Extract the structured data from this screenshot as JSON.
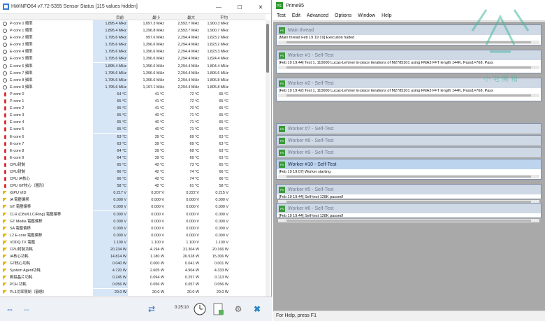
{
  "hwinfo": {
    "title": "HWiNFO64 v7.72-5355 Sensor Status [115 values hidden]",
    "headers": {
      "current": "目前",
      "min": "最小",
      "max": "最大",
      "avg": "平均"
    },
    "rows": [
      {
        "icon": "clock-icon",
        "name": "P-core 0 頻率",
        "cur": "1,895.4 MHz",
        "min": "1,097.3 MHz",
        "max": "2,593.7 MHz",
        "avg": "1,900.3 MHz"
      },
      {
        "icon": "clock-icon",
        "name": "P-core 1 頻率",
        "cur": "1,895.4 MHz",
        "min": "1,296.8 MHz",
        "max": "2,593.7 MHz",
        "avg": "1,900.7 MHz"
      },
      {
        "icon": "clock-icon",
        "name": "E-core 2 頻率",
        "cur": "1,795.6 MHz",
        "min": "997.6 MHz",
        "max": "2,294.4 MHz",
        "avg": "1,823.2 MHz"
      },
      {
        "icon": "clock-icon",
        "name": "E-core 3 頻率",
        "cur": "1,795.6 MHz",
        "min": "1,396.6 MHz",
        "max": "2,294.4 MHz",
        "avg": "1,823.2 MHz"
      },
      {
        "icon": "clock-icon",
        "name": "E-core 4 頻率",
        "cur": "1,795.6 MHz",
        "min": "1,396.6 MHz",
        "max": "2,294.4 MHz",
        "avg": "1,823.3 MHz"
      },
      {
        "icon": "clock-icon",
        "name": "E-core 5 頻率",
        "cur": "1,795.6 MHz",
        "min": "1,396.6 MHz",
        "max": "2,294.4 MHz",
        "avg": "1,824.4 MHz"
      },
      {
        "icon": "clock-icon",
        "name": "E-core 6 頻率",
        "cur": "1,895.4 MHz",
        "min": "1,396.6 MHz",
        "max": "2,294.4 MHz",
        "avg": "1,804.4 MHz"
      },
      {
        "icon": "clock-icon",
        "name": "E-core 7 頻率",
        "cur": "1,795.6 MHz",
        "min": "1,396.6 MHz",
        "max": "2,294.4 MHz",
        "avg": "1,806.6 MHz"
      },
      {
        "icon": "clock-icon",
        "name": "E-core 8 頻率",
        "cur": "1,795.6 MHz",
        "min": "1,396.6 MHz",
        "max": "2,294.4 MHz",
        "avg": "1,806.8 MHz"
      },
      {
        "icon": "clock-icon",
        "name": "E-core 9 頻率",
        "cur": "1,795.6 MHz",
        "min": "1,197.1 MHz",
        "max": "2,294.4 MHz",
        "avg": "1,805.8 MHz"
      },
      {
        "icon": "thermometer-icon",
        "name": "P-core 0",
        "cur": "64 °C",
        "min": "41 °C",
        "max": "72 °C",
        "avg": "65 °C"
      },
      {
        "icon": "thermometer-icon",
        "name": "P-core 1",
        "cur": "65 °C",
        "min": "41 °C",
        "max": "72 °C",
        "avg": "65 °C"
      },
      {
        "icon": "thermometer-icon",
        "name": "E-core 2",
        "cur": "65 °C",
        "min": "41 °C",
        "max": "70 °C",
        "avg": "65 °C"
      },
      {
        "icon": "thermometer-icon",
        "name": "E-core 3",
        "cur": "65 °C",
        "min": "40 °C",
        "max": "71 °C",
        "avg": "65 °C"
      },
      {
        "icon": "thermometer-icon",
        "name": "E-core 4",
        "cur": "65 °C",
        "min": "40 °C",
        "max": "71 °C",
        "avg": "65 °C"
      },
      {
        "icon": "thermometer-icon",
        "name": "E-core 5",
        "cur": "65 °C",
        "min": "40 °C",
        "max": "71 °C",
        "avg": "65 °C"
      },
      {
        "icon": "thermometer-icon",
        "name": "E-core 6",
        "cur": "63 °C",
        "min": "39 °C",
        "max": "69 °C",
        "avg": "63 °C"
      },
      {
        "icon": "thermometer-icon",
        "name": "E-core 7",
        "cur": "63 °C",
        "min": "39 °C",
        "max": "69 °C",
        "avg": "63 °C"
      },
      {
        "icon": "thermometer-icon",
        "name": "E-core 8",
        "cur": "64 °C",
        "min": "39 °C",
        "max": "69 °C",
        "avg": "63 °C"
      },
      {
        "icon": "thermometer-icon",
        "name": "E-core 9",
        "cur": "64 °C",
        "min": "39 °C",
        "max": "69 °C",
        "avg": "63 °C"
      },
      {
        "icon": "thermometer-icon",
        "name": "CPU封裝",
        "cur": "65 °C",
        "min": "42 °C",
        "max": "73 °C",
        "avg": "65 °C"
      },
      {
        "icon": "thermometer-icon",
        "name": "CPU封裝",
        "cur": "66 °C",
        "min": "42 °C",
        "max": "74 °C",
        "avg": "66 °C"
      },
      {
        "icon": "thermometer-icon",
        "name": "CPU IA核心",
        "cur": "66 °C",
        "min": "42 °C",
        "max": "74 °C",
        "avg": "66 °C"
      },
      {
        "icon": "thermometer-icon",
        "name": "CPU GT核心（圖形）",
        "cur": "58 °C",
        "min": "42 °C",
        "max": "61 °C",
        "avg": "58 °C"
      },
      {
        "icon": "bolt-icon",
        "name": "iGPU VID",
        "cur": "0.217 V",
        "min": "0.207 V",
        "max": "0.222 V",
        "avg": "0.215 V"
      },
      {
        "icon": "bolt-icon",
        "name": "IA 電壓偏移",
        "cur": "0.000 V",
        "min": "0.000 V",
        "max": "0.000 V",
        "avg": "0.000 V"
      },
      {
        "icon": "bolt-icon",
        "name": "GT 電壓偏移",
        "cur": "0.000 V",
        "min": "0.000 V",
        "max": "0.000 V",
        "avg": "0.000 V"
      },
      {
        "icon": "bolt-icon",
        "name": "CLR (CBo/LLC/Ring) 電壓偏移",
        "cur": "0.000 V",
        "min": "0.000 V",
        "max": "0.000 V",
        "avg": "0.000 V"
      },
      {
        "icon": "bolt-icon",
        "name": "GT Media 電壓偏移",
        "cur": "0.000 V",
        "min": "0.000 V",
        "max": "0.000 V",
        "avg": "0.000 V"
      },
      {
        "icon": "bolt-icon",
        "name": "SA 電壓偏移",
        "cur": "0.000 V",
        "min": "0.000 V",
        "max": "0.000 V",
        "avg": "0.000 V"
      },
      {
        "icon": "bolt-icon",
        "name": "L2 E-core 電壓偏移",
        "cur": "0.000 V",
        "min": "0.000 V",
        "max": "0.000 V",
        "avg": "0.000 V"
      },
      {
        "icon": "bolt-icon",
        "name": "VDDQ TX 電壓",
        "cur": "1.100 V",
        "min": "1.100 V",
        "max": "1.100 V",
        "avg": "1.100 V"
      },
      {
        "icon": "bolt-icon",
        "name": "CPU封裝功耗",
        "cur": "20.234 W",
        "min": "4.194 W",
        "max": "31.304 W",
        "avg": "20.166 W"
      },
      {
        "icon": "bolt-icon",
        "name": "IA核心功耗",
        "cur": "14.814 W",
        "min": "1.180 W",
        "max": "26.528 W",
        "avg": "15.306 W"
      },
      {
        "icon": "bolt-icon",
        "name": "GT核心功耗",
        "cur": "0.040 W",
        "min": "0.000 W",
        "max": "0.041 W",
        "avg": "0.001 W"
      },
      {
        "icon": "bolt-icon",
        "name": "System Agent功耗",
        "cur": "4.720 W",
        "min": "2.605 W",
        "max": "4.904 W",
        "avg": "4.333 W"
      },
      {
        "icon": "bolt-icon",
        "name": "剩餘晶片功耗",
        "cur": "0.245 W",
        "min": "0.094 W",
        "max": "0.257 W",
        "avg": "0.113 W"
      },
      {
        "icon": "bolt-icon",
        "name": "PCH 功耗",
        "cur": "0.056 W",
        "min": "0.056 W",
        "max": "0.057 W",
        "avg": "0.056 W"
      },
      {
        "icon": "bolt-icon",
        "name": "PL1功率限制（靜態）",
        "cur": "20.0 W",
        "min": "20.0 W",
        "max": "20.0 W",
        "avg": "20.0 W"
      }
    ],
    "elapsed": "0:25:10"
  },
  "prime": {
    "title": "Prime95",
    "menu": [
      "Test",
      "Edit",
      "Advanced",
      "Options",
      "Window",
      "Help"
    ],
    "windows": [
      {
        "caption": "Main thread",
        "body": "[Main thread Feb 19 19:19] Execution halted",
        "active": false
      },
      {
        "caption": "Worker #1 - Self-Test",
        "body": "[Feb 19 19:44] Test 1, 110000 Lucas-Lehmer in-place iterations of M2785201 using FMA3 FFT length 144K, Pass1=768, Pass",
        "active": false
      },
      {
        "caption": "Worker #2 - Self-Test",
        "body": "[Feb 19 19:42] Test 1, 110000 Lucas-Lehmer in-place iterations of M2785201 using FMA3 FFT length 144K, Pass1=768, Pass",
        "active": false
      },
      {
        "caption": "Worker #7 - Self-Test",
        "body": "",
        "active": false
      },
      {
        "caption": "Worker #8 - Self-Test",
        "body": "",
        "active": false
      },
      {
        "caption": "Worker #9 - Self-Test",
        "body": "",
        "active": false
      },
      {
        "caption": "Worker #10 - Self-Test",
        "body": "[Feb 19 19:07] Worker starting",
        "active": true
      },
      {
        "caption": "Worker #5 - Self-Test",
        "body": "[Feb 19 19:44] Self-test 128K passed!",
        "active": false
      },
      {
        "caption": "Worker #6 - Self-Test",
        "body": "[Feb 19 19:44] Self-test 128K passed!",
        "active": false
      }
    ],
    "status": "For Help, press F1"
  },
  "watermark": "小毛開箱"
}
